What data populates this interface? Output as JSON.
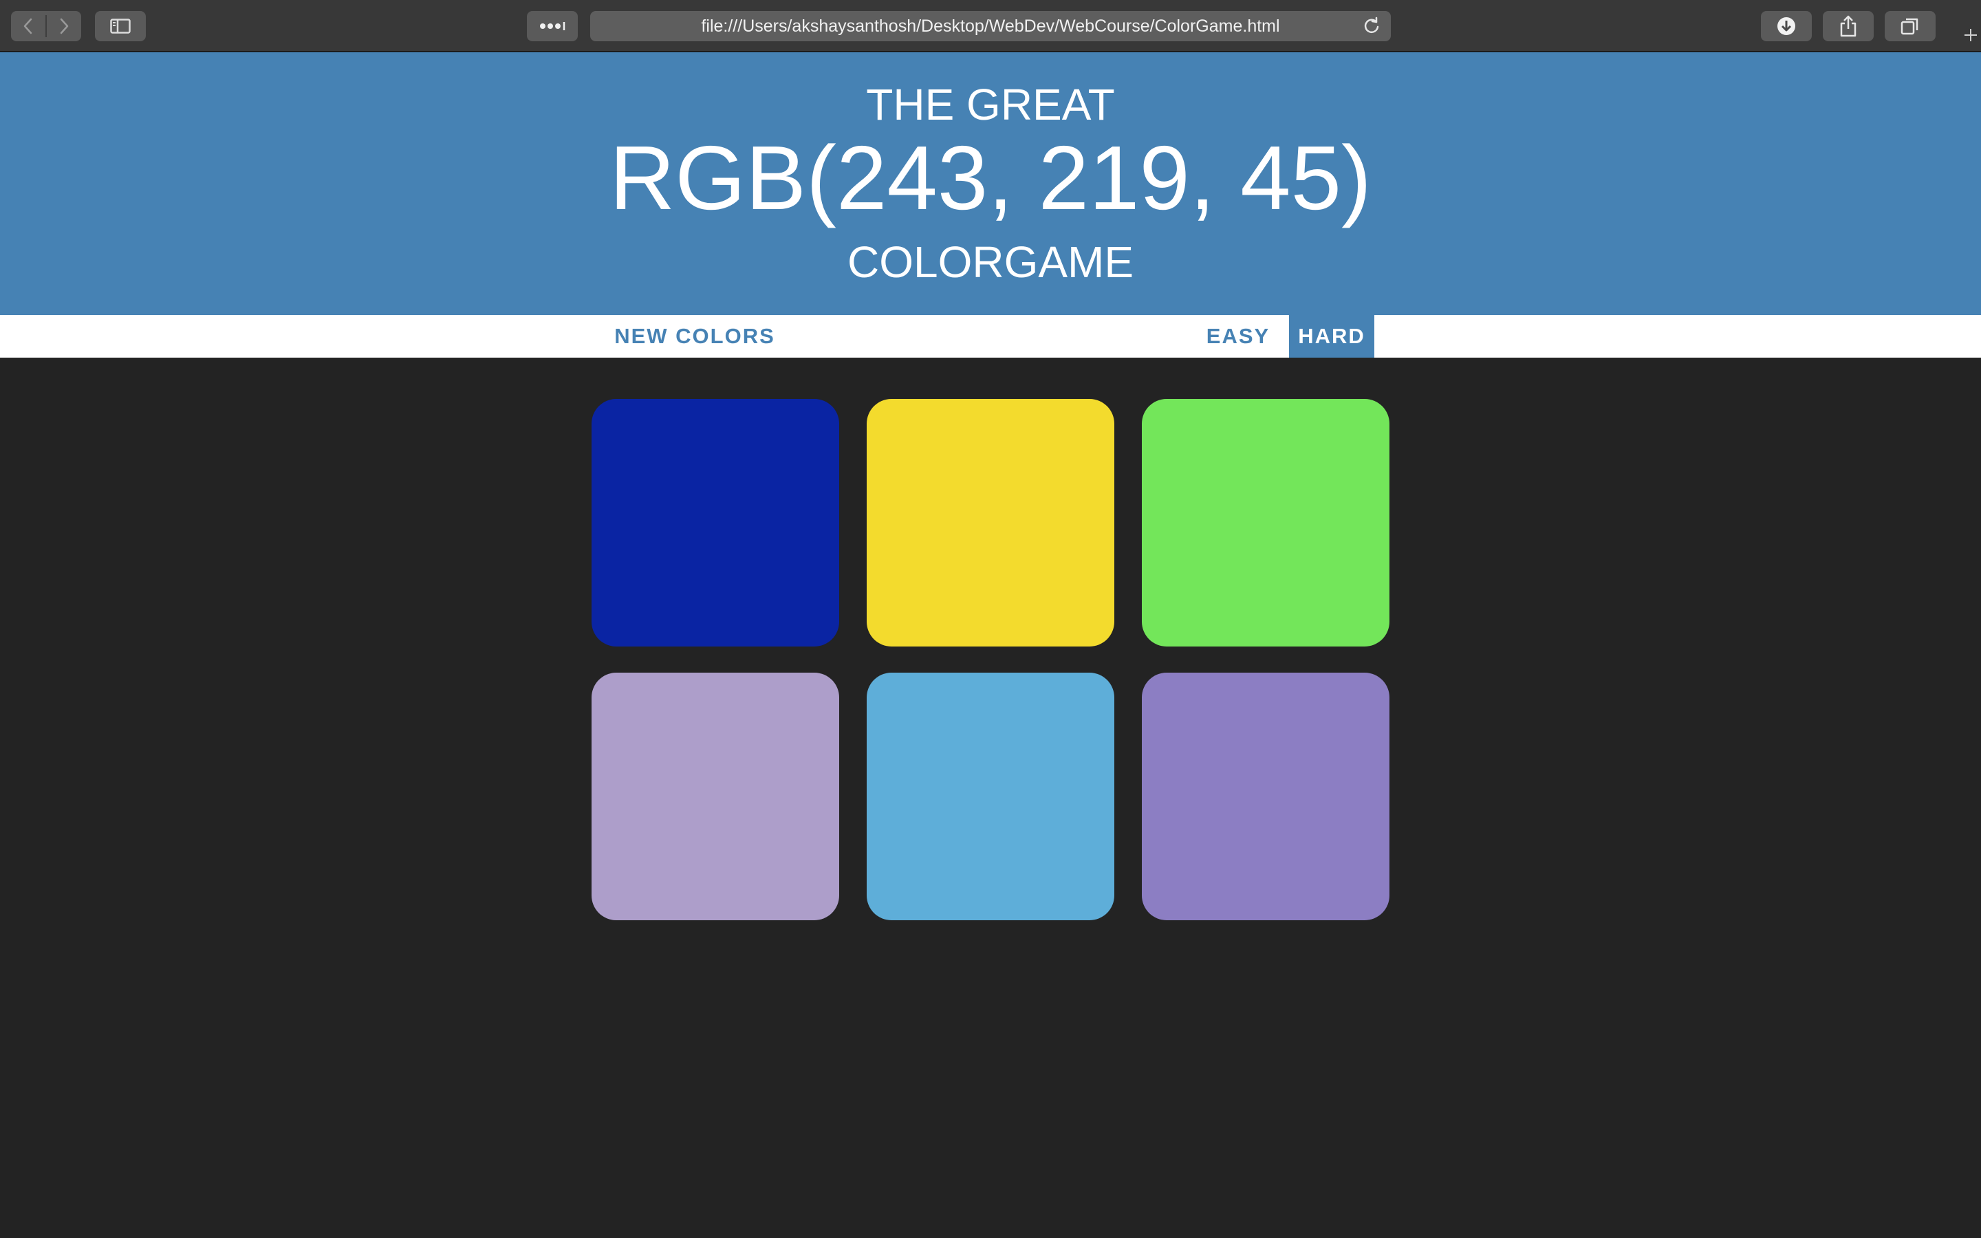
{
  "browser": {
    "url": "file:///Users/akshaysanthosh/Desktop/WebDev/WebCourse/ColorGame.html",
    "icons": {
      "back": "chevron-left-icon",
      "forward": "chevron-right-icon",
      "sidebar": "sidebar-icon",
      "extensions": "more-dots-icon",
      "reload": "reload-icon",
      "downloads": "download-icon",
      "share": "share-icon",
      "tabs": "tabs-overview-icon",
      "new_tab": "plus-icon"
    }
  },
  "header": {
    "line1": "THE GREAT",
    "rgb_display": "RGB(243, 219, 45)",
    "line3": "COLORGAME",
    "background": "#4682b4"
  },
  "stripe": {
    "reset_label": "NEW COLORS",
    "message": "",
    "easy_label": "EASY",
    "hard_label": "HARD",
    "selected_mode": "HARD"
  },
  "squares": [
    {
      "color": "#0a24a3"
    },
    {
      "color": "#f3db2d"
    },
    {
      "color": "#73e65a"
    },
    {
      "color": "#ad9eca"
    },
    {
      "color": "#5eaed9"
    },
    {
      "color": "#8c7ec3"
    }
  ],
  "colors": {
    "page_background": "#232323",
    "accent": "#4682b4"
  }
}
